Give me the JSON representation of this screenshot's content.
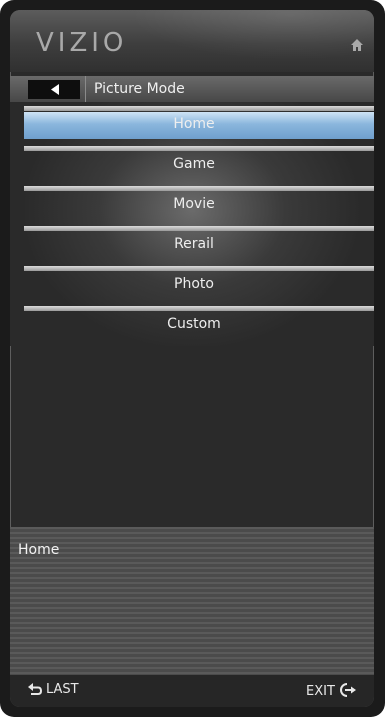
{
  "header": {
    "logo_text": "VIZIO",
    "home_icon": "home-icon"
  },
  "titlebar": {
    "back_icon": "back-arrow-icon",
    "title": "Picture Mode"
  },
  "menu": {
    "selected_index": 0,
    "items": [
      {
        "label": "Home"
      },
      {
        "label": "Game"
      },
      {
        "label": "Movie"
      },
      {
        "label": "Rerail"
      },
      {
        "label": "Photo"
      },
      {
        "label": "Custom"
      }
    ]
  },
  "description": {
    "text": "Home"
  },
  "footer": {
    "last_label": "LAST",
    "last_icon": "return-arrow-icon",
    "exit_label": "EXIT",
    "exit_icon": "exit-icon"
  },
  "colors": {
    "highlight": "#8ab6dd",
    "panel": "#2a2a2a",
    "text": "#eeeeee"
  }
}
